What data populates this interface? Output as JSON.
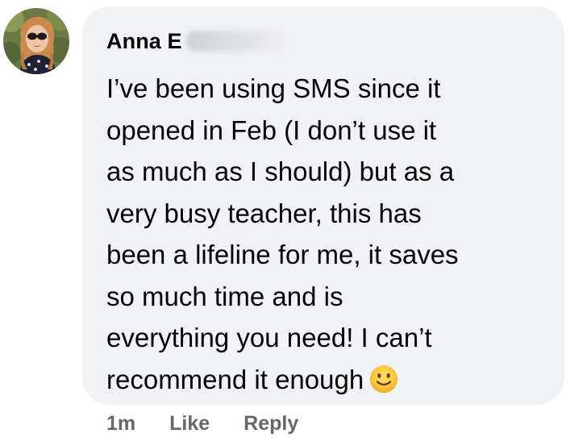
{
  "comment": {
    "author": {
      "name_visible": "Anna E",
      "avatar_icon": "profile-photo-icon"
    },
    "body_lines": [
      "I’ve been using SMS since it",
      "opened in Feb (I don’t use it",
      "as much as I should) but as a",
      "very busy teacher, this has",
      "been a lifeline for me, it saves",
      "so much time and is",
      "everything you need! I can’t",
      "recommend it enough"
    ],
    "emoji_icon": "slightly-smiling-face-emoji",
    "timestamp": "1m",
    "like_label": "Like",
    "reply_label": "Reply"
  },
  "colors": {
    "bubble_bg": "#f0f2f5",
    "text": "#050505",
    "meta_text": "#65676b"
  }
}
